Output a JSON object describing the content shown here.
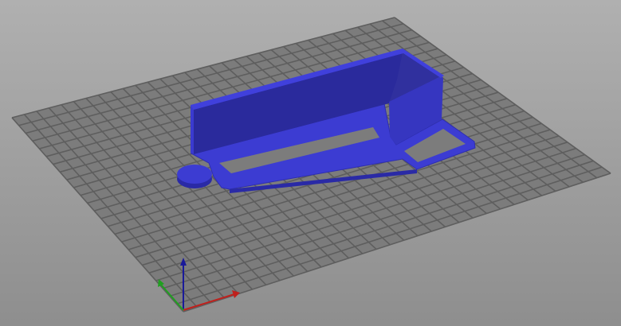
{
  "viewport": {
    "background_top": "#b0b0b0",
    "background_bottom": "#8e8e8e",
    "bed_color": "#7a7a7a",
    "grid_line_color": "#5e5e5e",
    "model_color": "#3a3ad0",
    "axes": {
      "x_color": "#c0201c",
      "y_color": "#20a020",
      "z_color": "#1a1a9a"
    }
  }
}
